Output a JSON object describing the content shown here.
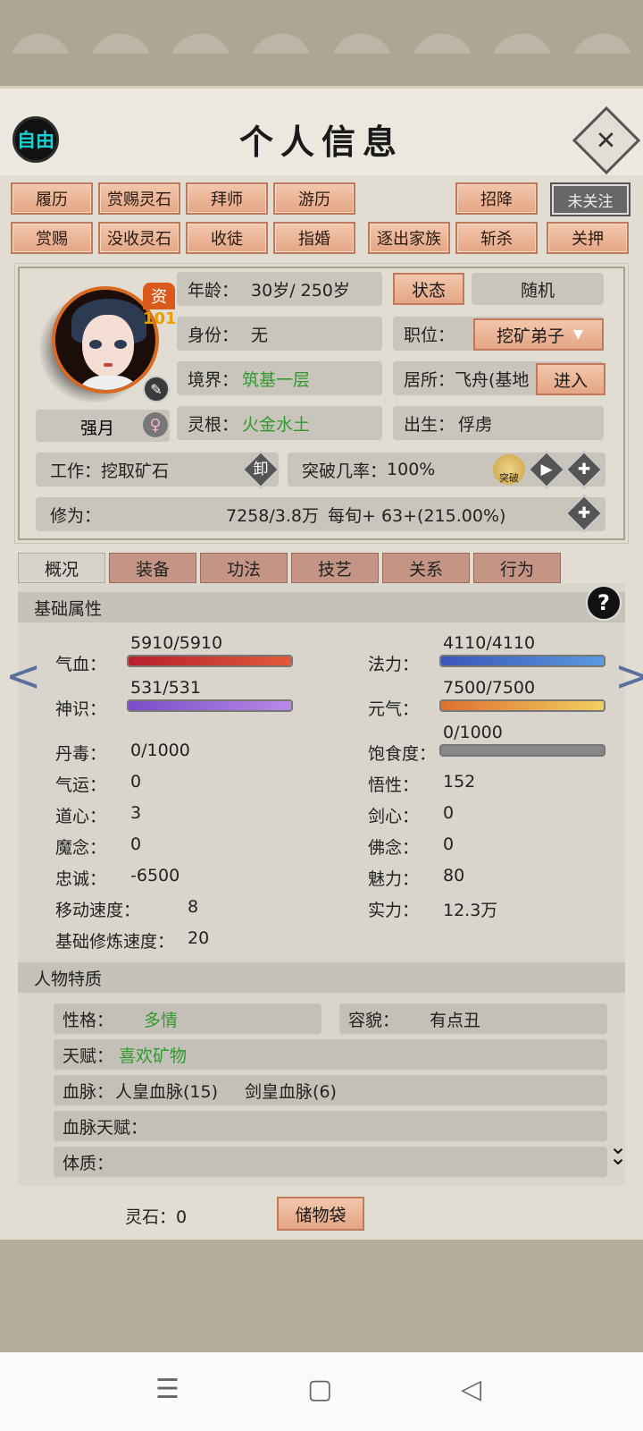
{
  "header": {
    "free_label": "自由",
    "title": "个人信息",
    "close_glyph": "✕"
  },
  "actions": {
    "row1": [
      "履历",
      "赏赐灵石",
      "拜师",
      "游历",
      "招降"
    ],
    "watch": "未关注",
    "row2": [
      "赏赐",
      "没收灵石",
      "收徒",
      "指婚",
      "逐出家族",
      "斩杀",
      "关押"
    ]
  },
  "profile": {
    "quality_label": "资",
    "quality_value": "101",
    "name": "强月",
    "gender_glyph": "♀",
    "age_label": "年龄：",
    "age_value": "30岁/ 250岁",
    "status_btn": "状态",
    "random_btn": "随机",
    "identity_label": "身份：",
    "identity_value": "无",
    "position_label": "职位：",
    "position_value": "挖矿弟子",
    "realm_label": "境界：",
    "realm_value": "筑基一层",
    "residence_label": "居所：",
    "residence_value": "飞舟(基地",
    "enter_btn": "进入",
    "root_label": "灵根：",
    "root_value": "火金水土",
    "birth_label": "出生：",
    "birth_value": "俘虏",
    "work_label": "工作：",
    "work_value": "挖取矿石",
    "unload_label": "卸",
    "break_label": "突破几率：",
    "break_value": "100%",
    "break_icon_text": "突破",
    "cultivation_label": "修为：",
    "cultivation_value": "7258/3.8万",
    "cultivation_rate": "每旬+  63+(215.00%)"
  },
  "tabs": [
    "概况",
    "装备",
    "功法",
    "技艺",
    "关系",
    "行为"
  ],
  "basic": {
    "section_title": "基础属性",
    "help": "?",
    "hp_label": "气血：",
    "hp_value": "5910/5910",
    "hp_fill": 1.0,
    "mp_label": "法力：",
    "mp_value": "4110/4110",
    "mp_fill": 1.0,
    "sense_label": "神识：",
    "sense_value": "531/531",
    "sense_fill": 1.0,
    "vital_label": "元气：",
    "vital_value": "7500/7500",
    "vital_fill": 1.0,
    "satiety_label": "饱食度：",
    "satiety_value": "0/1000",
    "satiety_fill": 0.0,
    "stats_left": [
      {
        "label": "丹毒：",
        "value": "0/1000"
      },
      {
        "label": "气运：",
        "value": "0"
      },
      {
        "label": "道心：",
        "value": "3"
      },
      {
        "label": "魔念：",
        "value": "0"
      },
      {
        "label": "忠诚：",
        "value": "-6500"
      },
      {
        "label": "移动速度：",
        "value": "8"
      },
      {
        "label": "基础修炼速度：",
        "value": "20"
      }
    ],
    "stats_right": [
      {
        "label": "悟性：",
        "value": "152"
      },
      {
        "label": "剑心：",
        "value": "0"
      },
      {
        "label": "佛念：",
        "value": "0"
      },
      {
        "label": "魅力：",
        "value": "80"
      },
      {
        "label": "实力：",
        "value": "12.3万"
      }
    ]
  },
  "traits": {
    "section_title": "人物特质",
    "personality_label": "性格：",
    "personality_value": "多情",
    "looks_label": "容貌：",
    "looks_value": "有点丑",
    "talent_label": "天赋：",
    "talent_value": "喜欢矿物",
    "blood_label": "血脉：",
    "blood_value1": "人皇血脉(15)",
    "blood_value2": "剑皇血脉(6)",
    "blood_talent_label": "血脉天赋：",
    "physique_label": "体质："
  },
  "footer": {
    "stone_label": "灵石：0",
    "bag_btn": "储物袋"
  },
  "colors": {
    "button_bg": "#e4a585",
    "hp": "#c0303a",
    "mp": "#4a6bc8",
    "sense": "#9a70d8",
    "vital": "#e8a030",
    "green_text": "#2e9b2e"
  }
}
